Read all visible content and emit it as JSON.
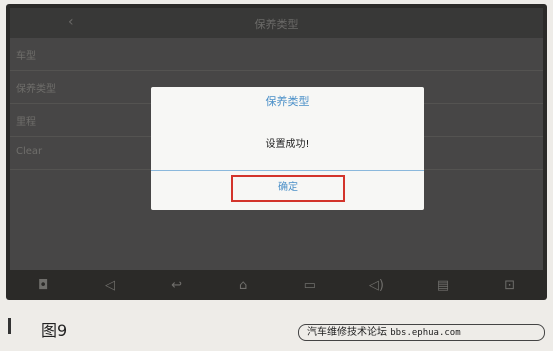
{
  "status_bar": {
    "title": "保养类型"
  },
  "background_rows": [
    {
      "label": "车型",
      "value": ""
    },
    {
      "label": "保养类型",
      "value": ""
    },
    {
      "label": "里程",
      "value": ""
    },
    {
      "label": "Clear",
      "value": ""
    }
  ],
  "dialog": {
    "title": "保养类型",
    "message": "设置成功!",
    "ok_label": "确定"
  },
  "nav_bar": {
    "icons": [
      "screenshot-icon",
      "volume-down-icon",
      "back-icon",
      "home-icon",
      "recents-icon",
      "volume-up-icon",
      "apps-icon",
      "car-icon"
    ],
    "glyphs": [
      "◘",
      "◁",
      "↩",
      "⌂",
      "▭",
      "◁)",
      "▤",
      "⊡"
    ]
  },
  "figure": {
    "label": "图9"
  },
  "watermark": {
    "text": "汽车维修技术论坛",
    "url": "bbs.ephua.com"
  },
  "colors": {
    "accent": "#4a8fc8",
    "highlight": "#d3342b",
    "dialog_bg": "#f7f7f5"
  }
}
